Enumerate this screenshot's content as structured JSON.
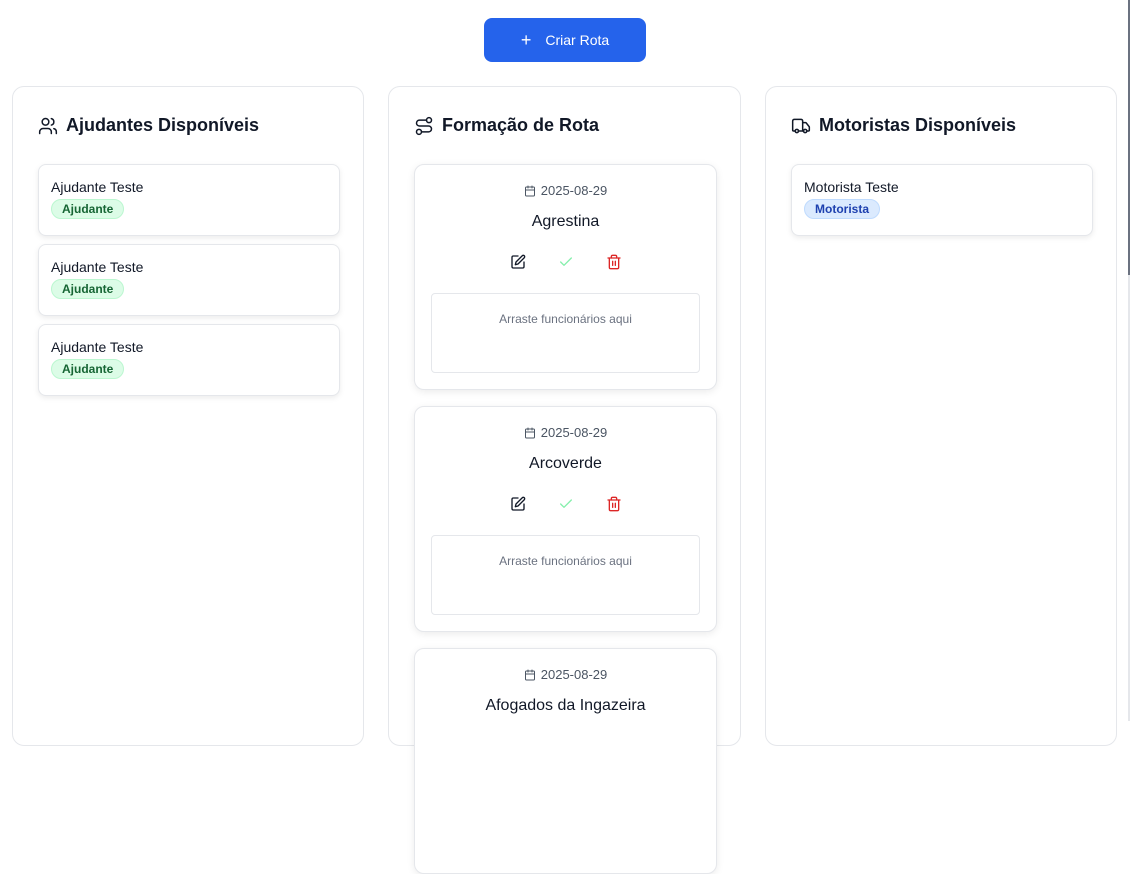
{
  "header": {
    "create_button_label": "Criar Rota",
    "create_button_icon": "plus-icon"
  },
  "colors": {
    "accent": "#2563eb",
    "green_badge": "#dcfce7",
    "blue_badge": "#dbeafe",
    "danger": "#dc2626",
    "success": "#86efac"
  },
  "helpers": {
    "title": "Ajudantes Disponíveis",
    "icon": "users-icon",
    "items": [
      {
        "name": "Ajudante Teste",
        "role": "Ajudante"
      },
      {
        "name": "Ajudante Teste",
        "role": "Ajudante"
      },
      {
        "name": "Ajudante Teste",
        "role": "Ajudante"
      }
    ]
  },
  "routes": {
    "title": "Formação de Rota",
    "icon": "route-icon",
    "drop_hint": "Arraste funcionários aqui",
    "items": [
      {
        "date": "2025-08-29",
        "name": "Agrestina"
      },
      {
        "date": "2025-08-29",
        "name": "Arcoverde"
      },
      {
        "date": "2025-08-29",
        "name": "Afogados da Ingazeira"
      }
    ]
  },
  "drivers": {
    "title": "Motoristas Disponíveis",
    "icon": "truck-icon",
    "items": [
      {
        "name": "Motorista Teste",
        "role": "Motorista"
      }
    ]
  }
}
